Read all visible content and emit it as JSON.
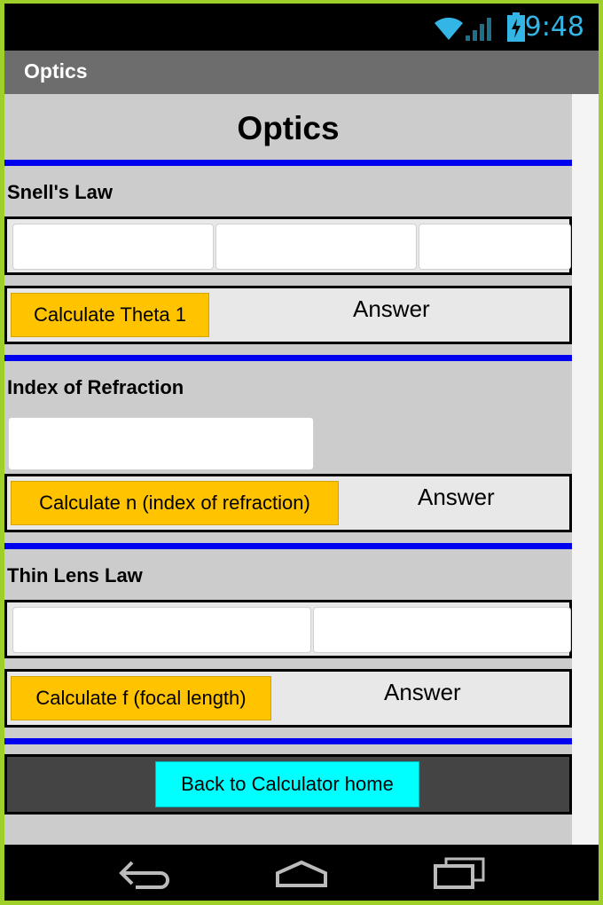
{
  "status_bar": {
    "time": "9:48",
    "icons": [
      "wifi-icon",
      "signal-icon",
      "battery-charging-icon"
    ],
    "accent_color": "#33b5e5"
  },
  "title_bar": {
    "title": "Optics"
  },
  "page": {
    "heading": "Optics",
    "rule_color": "#0000ee",
    "snell": {
      "label": "Snell's Law",
      "inputs": [
        "",
        "",
        ""
      ],
      "button": "Calculate Theta 1",
      "answer": "Answer"
    },
    "refraction": {
      "label": "Index of Refraction",
      "inputs": [
        ""
      ],
      "button": "Calculate n (index of refraction)",
      "answer": "Answer"
    },
    "thin_lens": {
      "label": "Thin Lens Law",
      "inputs": [
        "",
        ""
      ],
      "button": "Calculate f (focal length)",
      "answer": "Answer"
    },
    "back_button": "Back to Calculator home",
    "button_color": "#ffc300",
    "back_button_color": "#00ffff"
  },
  "nav_bar": {
    "icons": [
      "back-icon",
      "home-icon",
      "recent-apps-icon"
    ]
  }
}
